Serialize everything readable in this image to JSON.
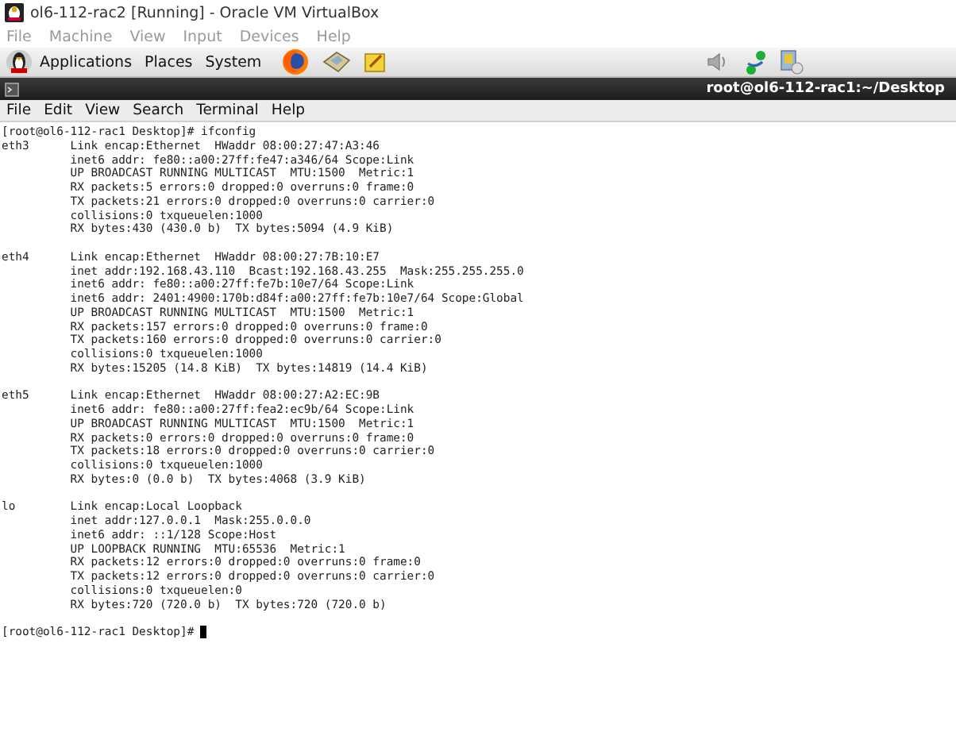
{
  "window": {
    "title": "ol6-112-rac2 [Running] - Oracle VM VirtualBox"
  },
  "menu": [
    {
      "label": "File",
      "disabled": true
    },
    {
      "label": "Machine",
      "disabled": true
    },
    {
      "label": "View",
      "disabled": true
    },
    {
      "label": "Input",
      "disabled": true
    },
    {
      "label": "Devices",
      "disabled": true
    },
    {
      "label": "Help",
      "disabled": true
    }
  ],
  "panel": {
    "menus": [
      "Applications",
      "Places",
      "System"
    ]
  },
  "terminal": {
    "title": "root@ol6-112-rac1:~/Desktop",
    "menu": [
      "File",
      "Edit",
      "View",
      "Search",
      "Terminal",
      "Help"
    ],
    "blocks": [
      {
        "lines": [
          "[root@ol6-112-rac1 Desktop]# ifconfig",
          "eth3      Link encap:Ethernet  HWaddr 08:00:27:47:A3:46",
          "          inet6 addr: fe80::a00:27ff:fe47:a346/64 Scope:Link",
          "          UP BROADCAST RUNNING MULTICAST  MTU:1500  Metric:1",
          "          RX packets:5 errors:0 dropped:0 overruns:0 frame:0",
          "          TX packets:21 errors:0 dropped:0 overruns:0 carrier:0",
          "          collisions:0 txqueuelen:1000",
          "          RX bytes:430 (430.0 b)  TX bytes:5094 (4.9 KiB)"
        ]
      },
      {
        "lines": [
          "eth4      Link encap:Ethernet  HWaddr 08:00:27:7B:10:E7",
          "          inet addr:192.168.43.110  Bcast:192.168.43.255  Mask:255.255.255.0",
          "          inet6 addr: fe80::a00:27ff:fe7b:10e7/64 Scope:Link",
          "          inet6 addr: 2401:4900:170b:d84f:a00:27ff:fe7b:10e7/64 Scope:Global",
          "          UP BROADCAST RUNNING MULTICAST  MTU:1500  Metric:1",
          "          RX packets:157 errors:0 dropped:0 overruns:0 frame:0",
          "          TX packets:160 errors:0 dropped:0 overruns:0 carrier:0",
          "          collisions:0 txqueuelen:1000",
          "          RX bytes:15205 (14.8 KiB)  TX bytes:14819 (14.4 KiB)"
        ]
      },
      {
        "lines": [
          "eth5      Link encap:Ethernet  HWaddr 08:00:27:A2:EC:9B",
          "          inet6 addr: fe80::a00:27ff:fea2:ec9b/64 Scope:Link",
          "          UP BROADCAST RUNNING MULTICAST  MTU:1500  Metric:1",
          "          RX packets:0 errors:0 dropped:0 overruns:0 frame:0",
          "          TX packets:18 errors:0 dropped:0 overruns:0 carrier:0",
          "          collisions:0 txqueuelen:1000",
          "          RX bytes:0 (0.0 b)  TX bytes:4068 (3.9 KiB)"
        ]
      },
      {
        "lines": [
          "lo        Link encap:Local Loopback",
          "          inet addr:127.0.0.1  Mask:255.0.0.0",
          "          inet6 addr: ::1/128 Scope:Host",
          "          UP LOOPBACK RUNNING  MTU:65536  Metric:1",
          "          RX packets:12 errors:0 dropped:0 overruns:0 frame:0",
          "          TX packets:12 errors:0 dropped:0 overruns:0 carrier:0",
          "          collisions:0 txqueuelen:0",
          "          RX bytes:720 (720.0 b)  TX bytes:720 (720.0 b)"
        ]
      }
    ],
    "prompt": "[root@ol6-112-rac1 Desktop]#"
  }
}
